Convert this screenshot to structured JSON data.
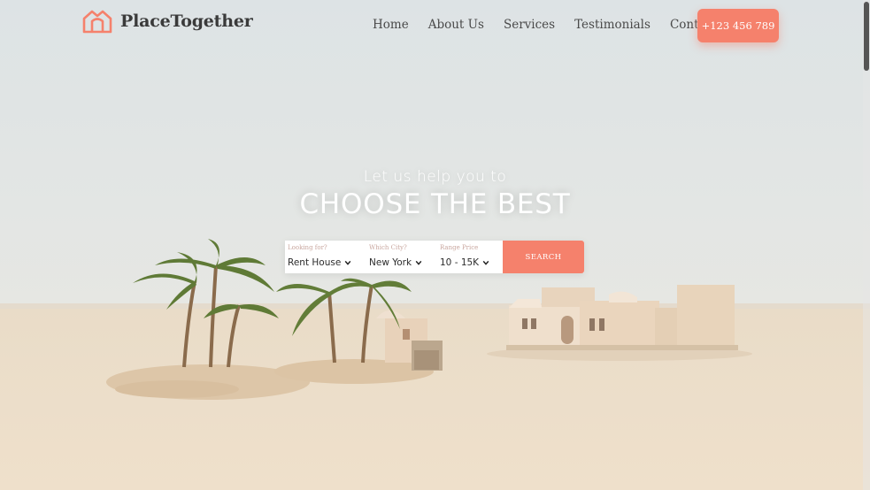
{
  "brand": {
    "name": "PlaceTogether",
    "accent_color": "#f5816c"
  },
  "nav": {
    "items": [
      {
        "label": "Home"
      },
      {
        "label": "About Us"
      },
      {
        "label": "Services"
      },
      {
        "label": "Testimonials"
      },
      {
        "label": "Contact Us"
      }
    ],
    "phone": "+123 456 789"
  },
  "hero": {
    "subtitle": "Let us help you to",
    "title": "CHOOSE THE BEST"
  },
  "search": {
    "fields": [
      {
        "label": "Looking for?",
        "value": "Rent House"
      },
      {
        "label": "Which City?",
        "value": "New York"
      },
      {
        "label": "Range Price",
        "value": "10 - 15K"
      }
    ],
    "button": "SEARCH"
  }
}
